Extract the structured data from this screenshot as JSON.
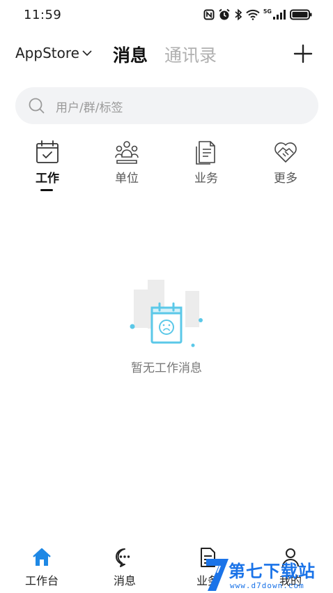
{
  "status_bar": {
    "time": "11:59",
    "network_label": "5G",
    "icons": [
      "nfc-icon",
      "alarm-icon",
      "bluetooth-icon",
      "wifi-icon",
      "signal-icon",
      "battery-icon"
    ]
  },
  "header": {
    "app_name": "AppStore",
    "tab_messages": "消息",
    "tab_contacts": "通讯录",
    "add_icon": "plus-icon"
  },
  "search": {
    "placeholder": "用户/群/标签",
    "icon": "search-icon"
  },
  "categories": [
    {
      "label": "工作",
      "icon": "calendar-check-icon",
      "active": true
    },
    {
      "label": "单位",
      "icon": "people-group-icon",
      "active": false
    },
    {
      "label": "业务",
      "icon": "document-icon",
      "active": false
    },
    {
      "label": "更多",
      "icon": "heart-handshake-icon",
      "active": false
    }
  ],
  "empty_state": {
    "text": "暂无工作消息",
    "icon": "sad-calendar-icon"
  },
  "bottom_nav": [
    {
      "label": "工作台",
      "icon": "home-icon"
    },
    {
      "label": "消息",
      "icon": "chat-bubble-icon"
    },
    {
      "label": "业务",
      "icon": "document-icon"
    },
    {
      "label": "我的",
      "icon": "person-icon"
    }
  ],
  "watermark": {
    "title": "第七下载站",
    "url": "www.d7down.com"
  },
  "colors": {
    "accent": "#1e88e5",
    "empty_illustration": "#5bc8e8",
    "inactive_tab": "#b0b0b0",
    "search_bg": "#f2f3f5"
  }
}
